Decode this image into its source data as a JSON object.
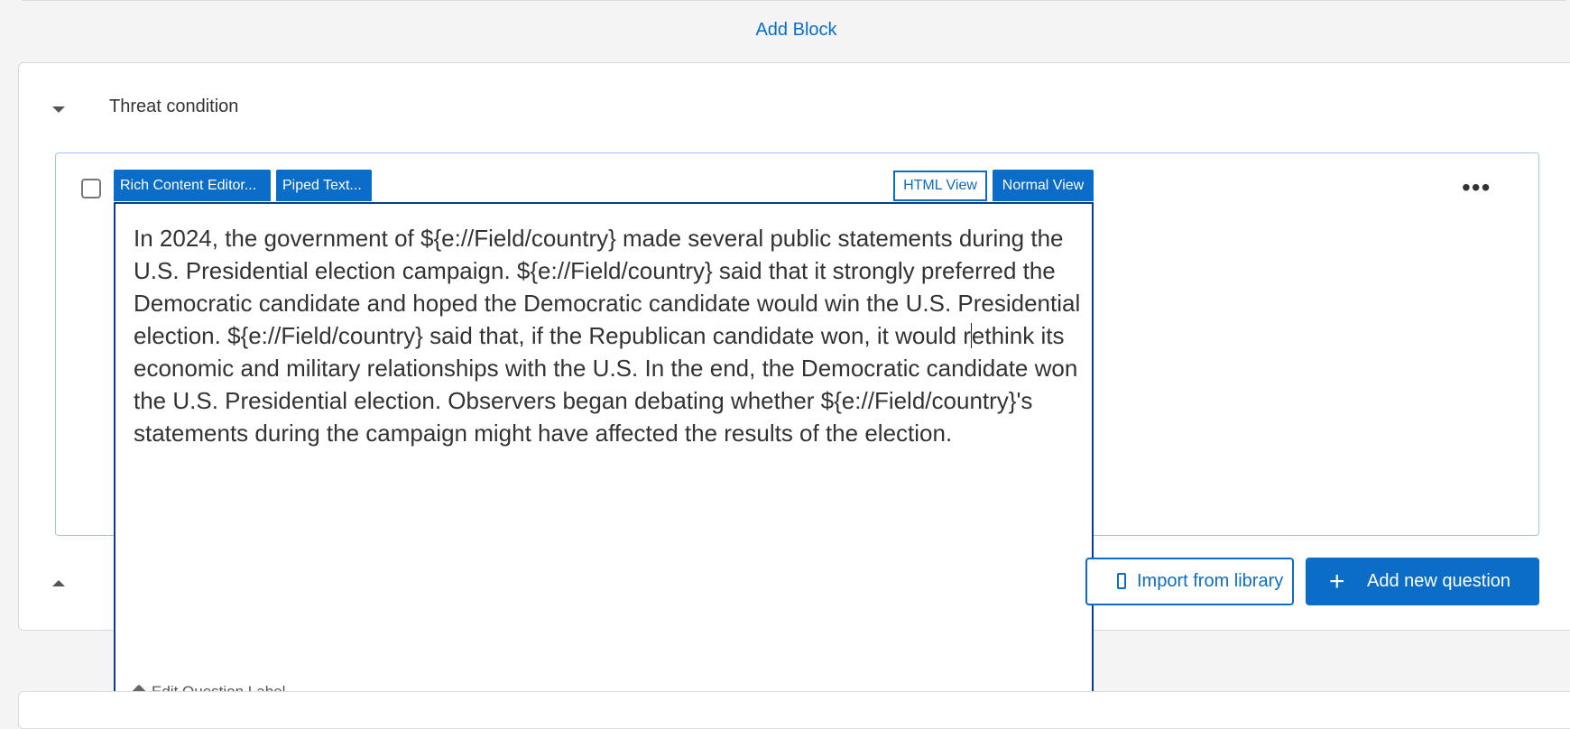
{
  "header": {
    "add_block_label": "Add Block"
  },
  "block": {
    "title": "Threat condition"
  },
  "editor_toolbar": {
    "rich_content_label": "Rich Content Editor...",
    "piped_text_label": "Piped Text...",
    "html_view_label": "HTML View",
    "normal_view_label": "Normal View"
  },
  "question": {
    "text_before_cursor": "In 2024, the government of ${e://Field/country} made several public statements during the U.S. Presidential election campaign. ${e://Field/country} said that it strongly preferred the Democratic candidate and hoped the Democratic candidate would win the U.S. Presidential election. ${e://Field/country} said that, if the Republican candidate won, it would r",
    "text_after_cursor": "ethink its economic and military relationships with the U.S. In the end, the Democratic candidate won the U.S. Presidential election. Observers began debating whether ${e://Field/country}'s statements during the campaign might have affected the results of the election.",
    "edit_label": "Edit Question Label"
  },
  "actions": {
    "import_label": "Import from library",
    "add_question_label": "Add new question",
    "add_question_icon": "+"
  },
  "icons": [
    "chevron-down-icon",
    "chevron-up-icon",
    "more-icon",
    "tag-icon",
    "book-icon",
    "plus-icon"
  ],
  "colors": {
    "accent": "#0b6dc7",
    "editor_border": "#0d3b85",
    "question_border": "#9cc7ea"
  }
}
